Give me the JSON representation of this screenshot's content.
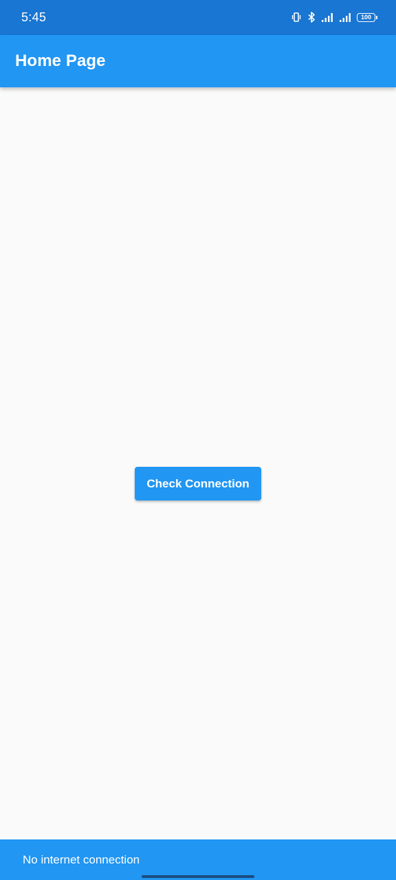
{
  "status_bar": {
    "time": "5:45",
    "battery_level": "100",
    "icons": [
      "vibrate-icon",
      "bluetooth-icon",
      "signal-icon",
      "signal-icon",
      "battery-icon"
    ]
  },
  "app_bar": {
    "title": "Home Page",
    "color": "#2196f3"
  },
  "main": {
    "check_button_label": "Check Connection"
  },
  "snackbar": {
    "message": "No internet connection"
  },
  "colors": {
    "primary": "#2196f3",
    "status_bar": "#1976d2",
    "background": "#fafafa"
  }
}
